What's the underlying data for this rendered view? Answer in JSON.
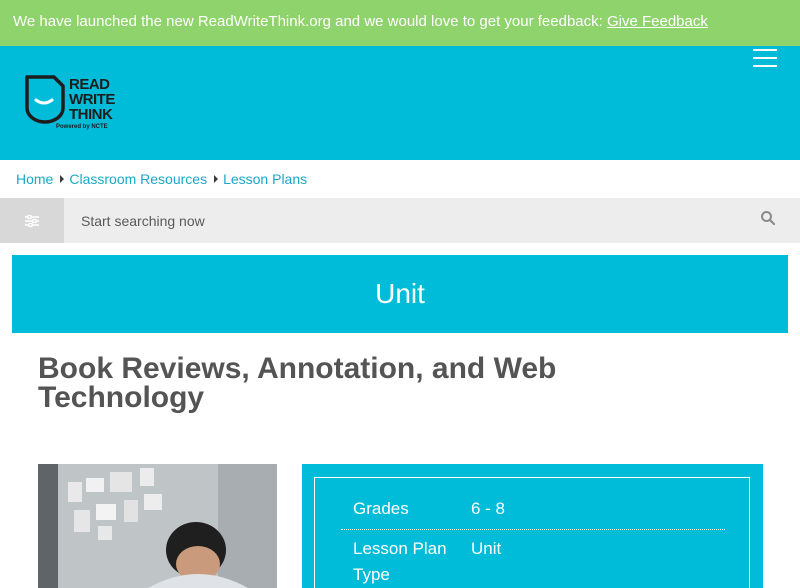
{
  "banner": {
    "text": "We have launched the new ReadWriteThink.org and we would love to get your feedback: ",
    "link_label": "Give Feedback"
  },
  "header": {
    "logo_lines": [
      "READ",
      "WRITE",
      "THINK"
    ],
    "logo_tagline": "Powered by NCTE",
    "menu_icon": "hamburger-icon"
  },
  "breadcrumb": {
    "items": [
      "Home",
      "Classroom Resources",
      "Lesson Plans"
    ]
  },
  "search": {
    "placeholder": "Start searching now",
    "filter_icon": "sliders-icon",
    "search_icon": "magnifier-icon"
  },
  "resource_type": "Unit",
  "title": "Book Reviews, Annotation, and Web Technology",
  "info": {
    "rows": [
      {
        "label": "Grades",
        "value": "6 - 8"
      },
      {
        "label": "Lesson Plan Type",
        "value": "Unit"
      }
    ]
  },
  "colors": {
    "banner_green": "#8fd36c",
    "brand_cyan": "#00bcd9",
    "link_blue": "#1aa8c7",
    "title_gray": "#545454"
  }
}
